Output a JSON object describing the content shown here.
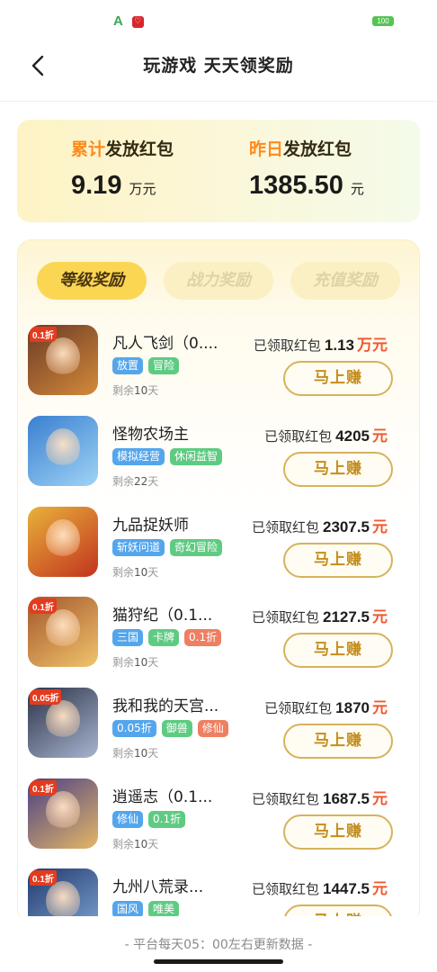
{
  "status_bar": {
    "left_icons": [
      "app-a-icon",
      "red-app-icon"
    ],
    "a_label": "A",
    "red_label": "♡",
    "battery": "100"
  },
  "nav": {
    "title": "玩游戏 天天领奖励"
  },
  "summary": {
    "total": {
      "label_hl": "累计",
      "label_rest": "发放红包",
      "value": "9.19",
      "unit": "万元"
    },
    "yesterday": {
      "label_hl": "昨日",
      "label_rest": "发放红包",
      "value": "1385.50",
      "unit": "元"
    }
  },
  "tabs": [
    "等级奖励",
    "战力奖励",
    "充值奖励"
  ],
  "reward_prefix": "已领取红包",
  "earn_label": "马上赚",
  "remain_prefix": "剩余",
  "remain_suffix": "天",
  "games": [
    {
      "name": "凡人飞剑（0....",
      "reward": "1.13",
      "unit": "万元",
      "tags": [
        {
          "t": "放置",
          "c": "blue"
        },
        {
          "t": "冒险",
          "c": "green"
        }
      ],
      "days": "10",
      "badge": "0.1折",
      "bg": "#6b3a26",
      "bg2": "#d38a3a"
    },
    {
      "name": "怪物农场主",
      "reward": "4205",
      "unit": "元",
      "tags": [
        {
          "t": "模拟经营",
          "c": "blue"
        },
        {
          "t": "休闲益智",
          "c": "green"
        }
      ],
      "days": "22",
      "badge": "",
      "bg": "#3a7fd0",
      "bg2": "#9fd4f6"
    },
    {
      "name": "九品捉妖师",
      "reward": "2307.5",
      "unit": "元",
      "tags": [
        {
          "t": "斩妖问道",
          "c": "blue"
        },
        {
          "t": "奇幻冒险",
          "c": "green"
        }
      ],
      "days": "10",
      "badge": "",
      "bg": "#e8b23a",
      "bg2": "#c2331f"
    },
    {
      "name": "猫狩纪（0.1...",
      "reward": "2127.5",
      "unit": "元",
      "tags": [
        {
          "t": "三国",
          "c": "blue"
        },
        {
          "t": "卡牌",
          "c": "green"
        },
        {
          "t": "0.1折",
          "c": "orange"
        }
      ],
      "days": "10",
      "badge": "0.1折",
      "bg": "#a3562b",
      "bg2": "#f0c46c"
    },
    {
      "name": "我和我的天宫...",
      "reward": "1870",
      "unit": "元",
      "tags": [
        {
          "t": "0.05折",
          "c": "blue"
        },
        {
          "t": "御兽",
          "c": "green"
        },
        {
          "t": "修仙",
          "c": "orange"
        }
      ],
      "days": "10",
      "badge": "0.05折",
      "bg": "#2b3348",
      "bg2": "#a8b4cf"
    },
    {
      "name": "逍遥志（0.1...",
      "reward": "1687.5",
      "unit": "元",
      "tags": [
        {
          "t": "修仙",
          "c": "blue"
        },
        {
          "t": "0.1折",
          "c": "green"
        }
      ],
      "days": "10",
      "badge": "0.1折",
      "bg": "#4a3f86",
      "bg2": "#e4b766"
    },
    {
      "name": "九州八荒录...",
      "reward": "1447.5",
      "unit": "元",
      "tags": [
        {
          "t": "国风",
          "c": "blue"
        },
        {
          "t": "唯美",
          "c": "green"
        }
      ],
      "days": "",
      "badge": "0.1折",
      "bg": "#23386b",
      "bg2": "#7fa9d9"
    }
  ],
  "footer": {
    "text": "- 平台每天05：00左右更新数据 -"
  }
}
